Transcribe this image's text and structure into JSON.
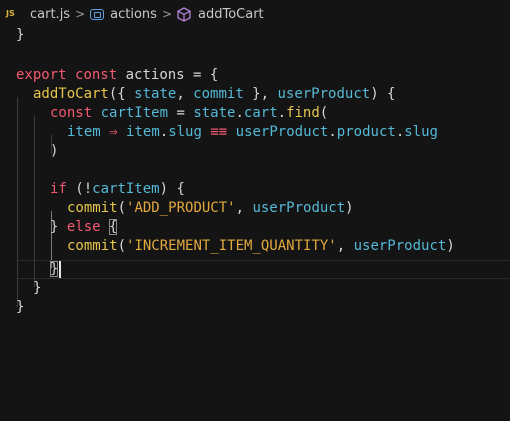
{
  "breadcrumb": {
    "file_icon": "js-file-icon",
    "file_badge": "JS",
    "file": "cart.js",
    "namespace_icon": "namespace-icon",
    "namespace": "actions",
    "method_icon": "method-cube-icon",
    "method": "addToCart",
    "separator": ">"
  },
  "colors": {
    "background": "#141414",
    "keyword": "#f35a6f",
    "function": "#e7c64c",
    "variable": "#55b8d6",
    "string": "#e1a93e",
    "text": "#d6d6d6"
  },
  "code": {
    "l0_close": "}",
    "l2_export": "export",
    "l2_const": "const",
    "l2_name": "actions",
    "l2_rest": " = {",
    "l3_fn": "addToCart",
    "l3_p1": "({ ",
    "l3_state": "state",
    "l3_comma": ", ",
    "l3_commit": "commit",
    "l3_p2": " }, ",
    "l3_up": "userProduct",
    "l3_p3": ") {",
    "l4_const": "const",
    "l4_var": "cartItem",
    "l4_eq": " = ",
    "l4_state": "state",
    "l4_dot1": ".",
    "l4_cart": "cart",
    "l4_dot2": ".",
    "l4_find": "find",
    "l4_paren": "(",
    "l5_item": "item",
    "l5_arrow": "⇒",
    "l5_item2": "item",
    "l5_dot": ".",
    "l5_slug": "slug",
    "l5_eqeq": "≡≡",
    "l5_up": "userProduct",
    "l5_dot2": ".",
    "l5_product": "product",
    "l5_dot3": ".",
    "l5_slug2": "slug",
    "l6_close": ")",
    "l8_if": "if",
    "l8_open": " (!",
    "l8_var": "cartItem",
    "l8_close": ") {",
    "l9_fn": "commit",
    "l9_open": "(",
    "l9_str": "'ADD_PRODUCT'",
    "l9_comma": ", ",
    "l9_up": "userProduct",
    "l9_close": ")",
    "l10_close": "}",
    "l10_else": "else",
    "l10_brace": "{",
    "l11_fn": "commit",
    "l11_open": "(",
    "l11_str": "'INCREMENT_ITEM_QUANTITY'",
    "l11_comma": ", ",
    "l11_up": "userProduct",
    "l11_close": ")",
    "l12_close": "}",
    "l13_close": "}",
    "l14_close": "}"
  }
}
